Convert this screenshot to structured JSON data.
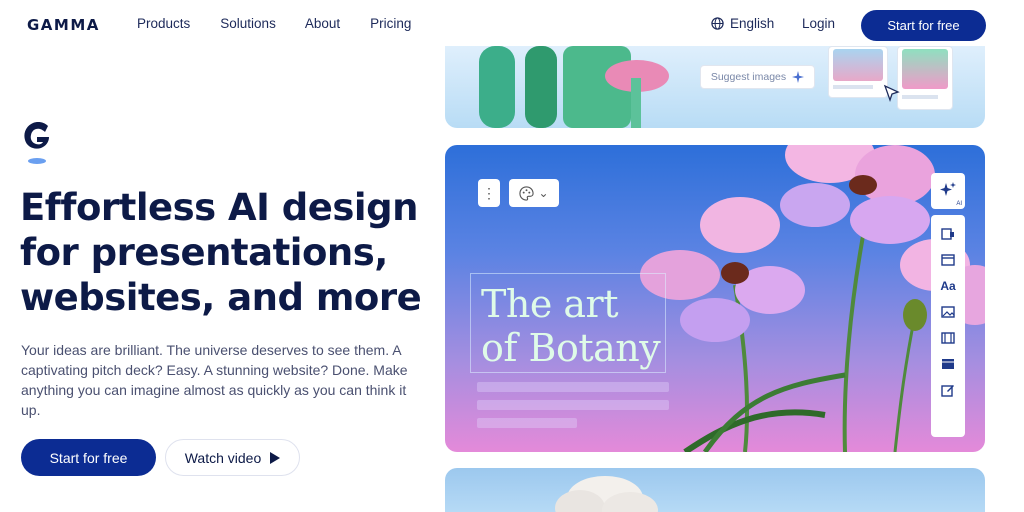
{
  "brand": {
    "logo_text": "GAMMA"
  },
  "nav": {
    "links": [
      "Products",
      "Solutions",
      "About",
      "Pricing"
    ],
    "language": "English",
    "login": "Login",
    "cta": "Start for free"
  },
  "hero": {
    "headline": "Effortless AI design for presentations, websites, and more",
    "subtext": "Your ideas are brilliant. The universe deserves to see them. A captivating pitch deck? Easy. A stunning website? Done. Make anything you can imagine almost as quickly as you can think it up.",
    "primary_button": "Start for free",
    "secondary_button": "Watch video"
  },
  "preview": {
    "suggest_images": "Suggest images",
    "card_title": "The art\nof Botany",
    "ai_badge": "AI",
    "toolbar_icons": [
      "cards-icon",
      "layout-icon",
      "text-icon",
      "image-icon",
      "video-icon",
      "embed-icon",
      "edit-icon"
    ]
  },
  "colors": {
    "brand_navy": "#0c2c93",
    "text_dark": "#0d1a47",
    "card_gradient_top": "#2d6fd9",
    "card_gradient_bottom": "#e48ad9"
  }
}
